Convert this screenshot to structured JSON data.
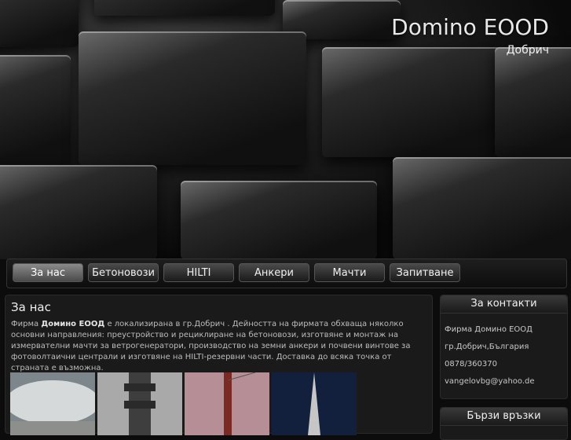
{
  "site": {
    "title": "Domino EOOD",
    "subtitle": "Добрич"
  },
  "nav": [
    {
      "label": "За нас",
      "active": true
    },
    {
      "label": "Бетоновози",
      "active": false
    },
    {
      "label": "HILTI",
      "active": false
    },
    {
      "label": "Анкери",
      "active": false
    },
    {
      "label": "Мачти",
      "active": false
    },
    {
      "label": "Запитване",
      "active": false
    }
  ],
  "main": {
    "heading": "За нас",
    "text_prefix": "Фирма ",
    "text_company": "Домино ЕООД",
    "text_body": " е локализирана в гр.Добрич . Дейността на фирмата обхваща няколко основни направления: преустройство и рециклиране на бетоновози, изготвяне и монтаж на измервателни мачти за ветрогенератори, производство на земни анкери и почвени винтове за фотоволтаични централи и изготвяне на HILTI-резервни части. Доставка до всяка точка от страната е възможна."
  },
  "contacts": {
    "heading": "За контакти",
    "lines": [
      "Фирма Домино ЕООД",
      "гр.Добрич,България",
      "0878/360370",
      "vangelovbg@yahoo.de"
    ]
  },
  "quick_links": {
    "heading": "Бързи връзки"
  },
  "thumbnails": [
    "concrete-mixer-photo",
    "hilti-part-photo",
    "mast-photo",
    "anchor-photo"
  ]
}
